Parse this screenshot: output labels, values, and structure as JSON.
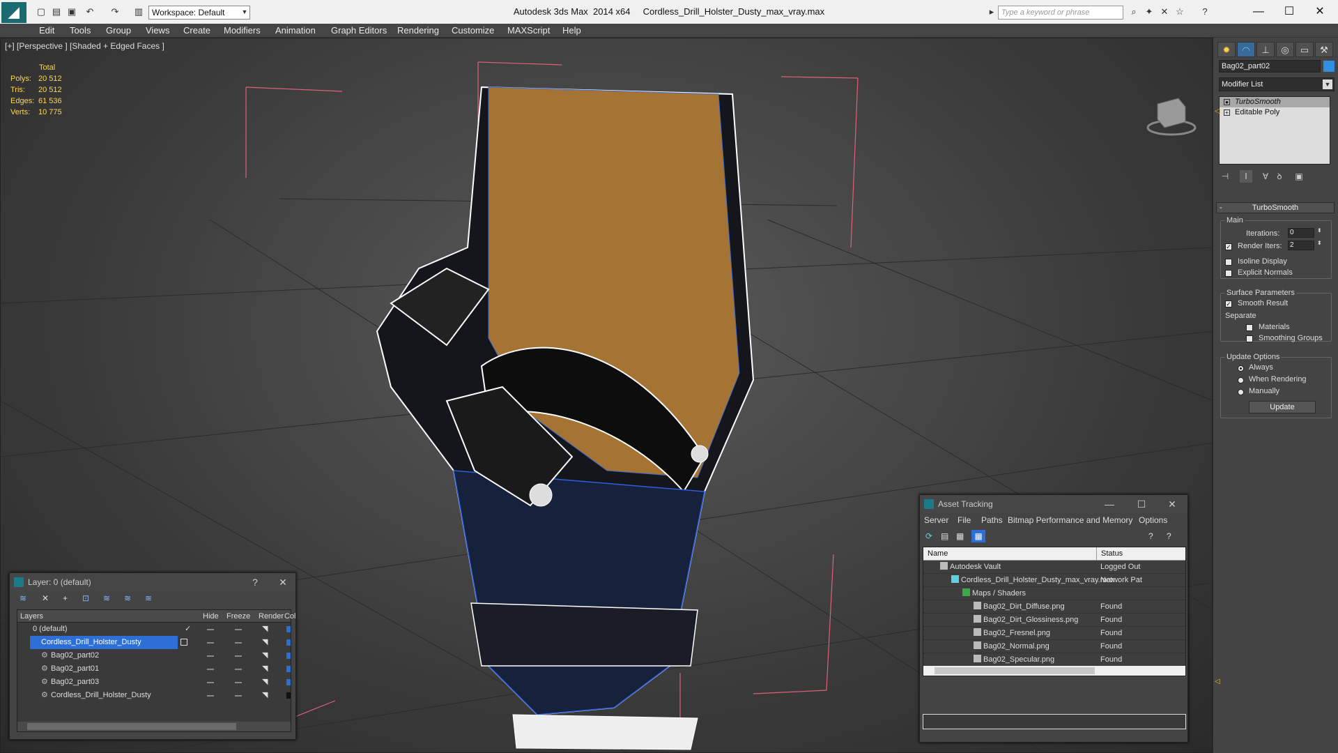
{
  "titlebar": {
    "workspace": "Workspace: Default",
    "app_title": "Autodesk 3ds Max  2014 x64     Cordless_Drill_Holster_Dusty_max_vray.max",
    "search_placeholder": "Type a keyword or phrase"
  },
  "menu": [
    "Edit",
    "Tools",
    "Group",
    "Views",
    "Create",
    "Modifiers",
    "Animation",
    "Graph Editors",
    "Rendering",
    "Customize",
    "MAXScript",
    "Help"
  ],
  "viewport": {
    "label": "[+] [Perspective ] [Shaded + Edged Faces ]",
    "stats": {
      "header": "Total",
      "rows": [
        {
          "label": "Polys:",
          "value": "20 512"
        },
        {
          "label": "Tris:",
          "value": "20 512"
        },
        {
          "label": "Edges:",
          "value": "61 536"
        },
        {
          "label": "Verts:",
          "value": "10 775"
        }
      ]
    }
  },
  "command_panel": {
    "object_name": "Bag02_part02",
    "object_color": "#2f8fe0",
    "modifier_list": "Modifier List",
    "stack": [
      "TurboSmooth",
      "Editable Poly"
    ],
    "rollout_title": "TurboSmooth",
    "main_group": "Main",
    "iterations_label": "Iterations:",
    "iterations_value": "0",
    "render_iters_label": "Render Iters:",
    "render_iters_value": "2",
    "isoline_display": "Isoline Display",
    "explicit_normals": "Explicit Normals",
    "surface_group": "Surface Parameters",
    "smooth_result": "Smooth Result",
    "separate": "Separate",
    "materials": "Materials",
    "smoothing_groups": "Smoothing Groups",
    "update_group": "Update Options",
    "always": "Always",
    "when_rendering": "When Rendering",
    "manually": "Manually",
    "update_button": "Update"
  },
  "layer_window": {
    "title": "Layer: 0 (default)",
    "columns": [
      "Layers",
      "Hide",
      "Freeze",
      "Render",
      "Col"
    ],
    "rows": [
      {
        "name": "0 (default)",
        "color": "#2f6fd0"
      },
      {
        "name": "Cordless_Drill_Holster_Dusty",
        "color": "#2f6fd0"
      },
      {
        "name": "Bag02_part02",
        "color": "#2f6fd0"
      },
      {
        "name": "Bag02_part01",
        "color": "#2f6fd0"
      },
      {
        "name": "Bag02_part03",
        "color": "#2f6fd0"
      },
      {
        "name": "Cordless_Drill_Holster_Dusty",
        "color": "#111111"
      }
    ]
  },
  "asset_window": {
    "title": "Asset Tracking",
    "menu": [
      "Server",
      "File",
      "Paths",
      "Bitmap Performance and Memory",
      "Options"
    ],
    "col_name": "Name",
    "col_status": "Status",
    "rows": [
      {
        "name": "Autodesk Vault",
        "status": "Logged Out"
      },
      {
        "name": "Cordless_Drill_Holster_Dusty_max_vray.max",
        "status": "Network Pat"
      },
      {
        "name": "Maps / Shaders",
        "status": ""
      },
      {
        "name": "Bag02_Dirt_Diffuse.png",
        "status": "Found"
      },
      {
        "name": "Bag02_Dirt_Glossiness.png",
        "status": "Found"
      },
      {
        "name": "Bag02_Fresnel.png",
        "status": "Found"
      },
      {
        "name": "Bag02_Normal.png",
        "status": "Found"
      },
      {
        "name": "Bag02_Specular.png",
        "status": "Found"
      }
    ]
  }
}
